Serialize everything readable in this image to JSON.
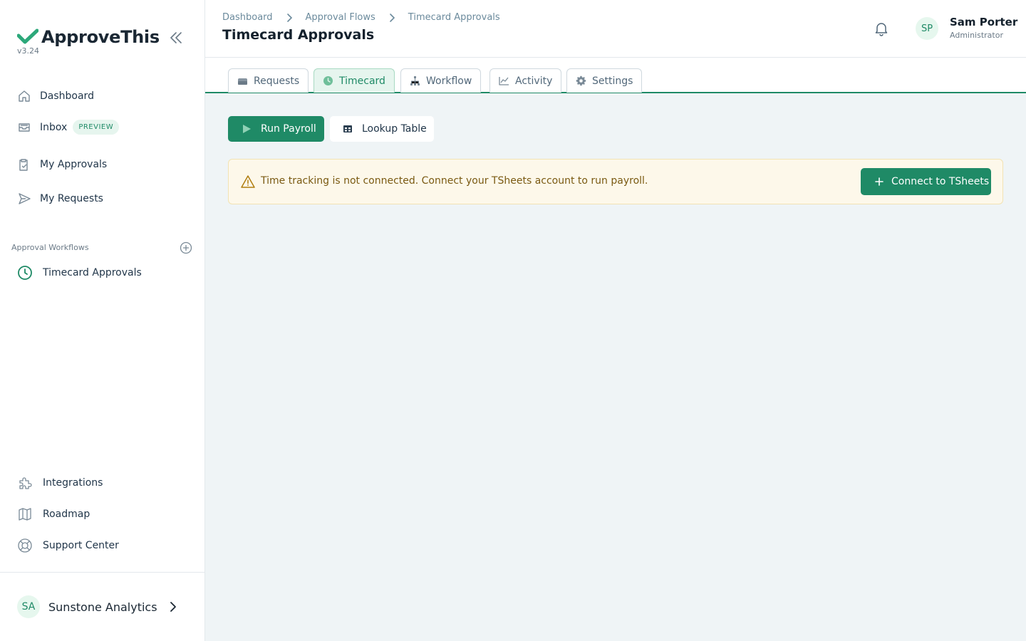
{
  "app": {
    "name": "ApproveThis",
    "version": "v3.24"
  },
  "sidebar": {
    "nav": [
      {
        "label": "Dashboard",
        "icon": "home-icon"
      },
      {
        "label": "Inbox",
        "icon": "inbox-icon",
        "badge": "PREVIEW"
      },
      {
        "label": "My Approvals",
        "icon": "clipboard-check-icon"
      },
      {
        "label": "My Requests",
        "icon": "send-icon"
      }
    ],
    "section_label": "Approval Workflows",
    "workflows": [
      {
        "label": "Timecard Approvals",
        "icon": "clock-icon"
      }
    ],
    "bottom": [
      {
        "label": "Integrations",
        "icon": "puzzle-icon"
      },
      {
        "label": "Roadmap",
        "icon": "map-icon"
      },
      {
        "label": "Support Center",
        "icon": "lifebuoy-icon"
      }
    ],
    "org": {
      "initials": "SA",
      "name": "Sunstone Analytics"
    }
  },
  "header": {
    "breadcrumbs": [
      "Dashboard",
      "Approval Flows",
      "Timecard Approvals"
    ],
    "title": "Timecard Approvals",
    "user": {
      "initials": "SP",
      "name": "Sam Porter",
      "role": "Administrator"
    }
  },
  "tabs": [
    {
      "label": "Requests",
      "icon": "tray-icon"
    },
    {
      "label": "Timecard",
      "icon": "clock-icon",
      "active": true
    },
    {
      "label": "Workflow",
      "icon": "sitemap-icon"
    },
    {
      "label": "Activity",
      "icon": "chart-line-icon"
    },
    {
      "label": "Settings",
      "icon": "gear-icon"
    }
  ],
  "actions": {
    "run_payroll": "Run Payroll",
    "lookup_table": "Lookup Table"
  },
  "alert": {
    "message": "Time tracking is not connected. Connect your TSheets account to run payroll.",
    "button": "Connect to TSheets"
  },
  "colors": {
    "accent": "#1f8a66",
    "content_bg": "#eff4f6",
    "alert_bg": "#fdf8ea",
    "alert_text": "#7a5a12"
  }
}
